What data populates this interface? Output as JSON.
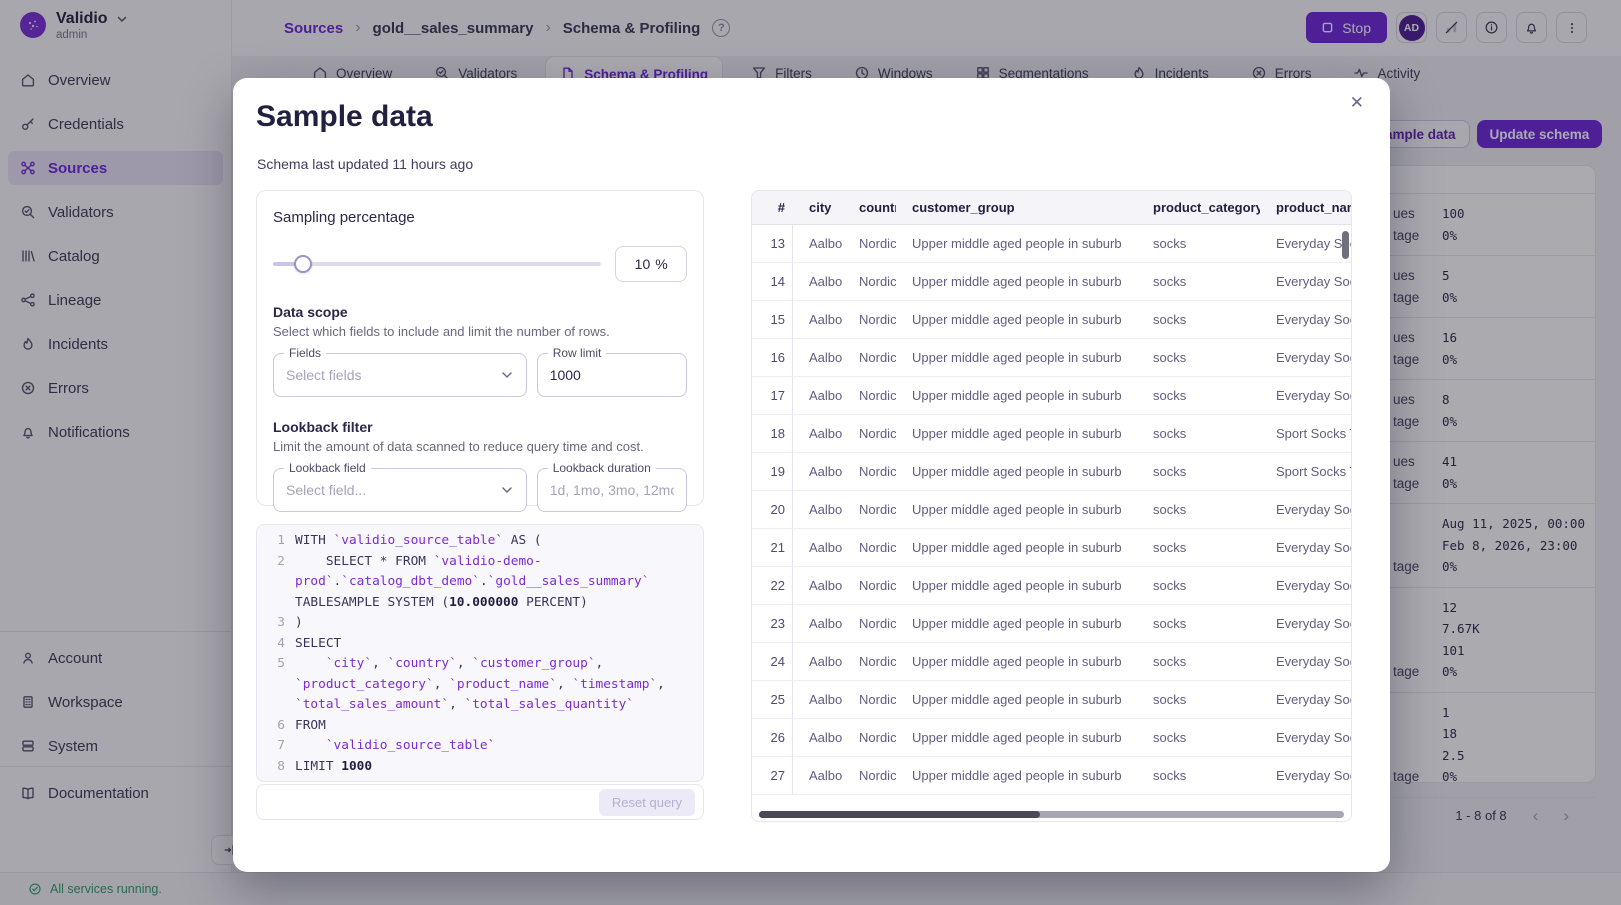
{
  "brand": {
    "name": "Validio",
    "role": "admin"
  },
  "sidebar": {
    "main": [
      {
        "label": "Overview",
        "icon": "home-icon",
        "active": false
      },
      {
        "label": "Credentials",
        "icon": "key-icon",
        "active": false
      },
      {
        "label": "Sources",
        "icon": "sources-icon",
        "active": true
      },
      {
        "label": "Validators",
        "icon": "validator-icon",
        "active": false
      },
      {
        "label": "Catalog",
        "icon": "catalog-icon",
        "active": false
      },
      {
        "label": "Lineage",
        "icon": "lineage-icon",
        "active": false
      },
      {
        "label": "Incidents",
        "icon": "flame-icon",
        "active": false
      },
      {
        "label": "Errors",
        "icon": "error-icon",
        "active": false
      },
      {
        "label": "Notifications",
        "icon": "bell-icon",
        "active": false
      }
    ],
    "secondary": [
      {
        "label": "Account",
        "icon": "person-icon"
      },
      {
        "label": "Workspace",
        "icon": "building-icon"
      },
      {
        "label": "System",
        "icon": "stack-icon"
      }
    ],
    "tertiary": [
      {
        "label": "Documentation",
        "icon": "book-icon"
      }
    ],
    "status": "All services running."
  },
  "header": {
    "breadcrumb": [
      {
        "label": "Sources",
        "link": true
      },
      {
        "label": "gold__sales_summary",
        "link": false
      },
      {
        "label": "Schema & Profiling",
        "link": false
      }
    ],
    "stop_label": "Stop",
    "avatar": "AD"
  },
  "tabs": [
    {
      "label": "Overview",
      "icon": "home-icon",
      "active": false
    },
    {
      "label": "Validators",
      "icon": "validator-icon",
      "active": false
    },
    {
      "label": "Schema & Profiling",
      "icon": "document-icon",
      "active": true
    },
    {
      "label": "Filters",
      "icon": "funnel-icon",
      "active": false
    },
    {
      "label": "Windows",
      "icon": "clock-icon",
      "active": false
    },
    {
      "label": "Segmentations",
      "icon": "grid-icon",
      "active": false
    },
    {
      "label": "Incidents",
      "icon": "flame-icon",
      "active": false
    },
    {
      "label": "Errors",
      "icon": "error-icon",
      "active": false
    },
    {
      "label": "Activity",
      "icon": "activity-icon",
      "active": false
    }
  ],
  "background_panel": {
    "sample_data_label": "Sample data",
    "update_schema_label": "Update schema",
    "stat_groups": [
      {
        "rows": [
          {
            "label": "ues",
            "value": "100"
          },
          {
            "label": "tage",
            "value": "0%"
          }
        ]
      },
      {
        "rows": [
          {
            "label": "ues",
            "value": "5"
          },
          {
            "label": "tage",
            "value": "0%"
          }
        ]
      },
      {
        "rows": [
          {
            "label": "ues",
            "value": "16"
          },
          {
            "label": "tage",
            "value": "0%"
          }
        ]
      },
      {
        "rows": [
          {
            "label": "ues",
            "value": "8"
          },
          {
            "label": "tage",
            "value": "0%"
          }
        ]
      },
      {
        "rows": [
          {
            "label": "ues",
            "value": "41"
          },
          {
            "label": "tage",
            "value": "0%"
          }
        ]
      },
      {
        "rows": [
          {
            "label": "",
            "value": "Aug 11, 2025, 00:00"
          },
          {
            "label": "",
            "value": "Feb 8, 2026, 23:00"
          },
          {
            "label": "tage",
            "value": "0%"
          }
        ]
      },
      {
        "rows": [
          {
            "label": "",
            "value": "12"
          },
          {
            "label": "",
            "value": "7.67K"
          },
          {
            "label": "",
            "value": "101"
          },
          {
            "label": "tage",
            "value": "0%"
          }
        ]
      },
      {
        "rows": [
          {
            "label": "",
            "value": "1"
          },
          {
            "label": "",
            "value": "18"
          },
          {
            "label": "",
            "value": "2.5"
          },
          {
            "label": "tage",
            "value": "0%"
          }
        ]
      }
    ],
    "pagination": "1 - 8 of 8"
  },
  "modal": {
    "title": "Sample data",
    "subtitle": "Schema last updated 11 hours ago",
    "sampling": {
      "label": "Sampling percentage",
      "value": "10",
      "unit": "%",
      "percent": 9
    },
    "data_scope": {
      "title": "Data scope",
      "description": "Select which fields to include and limit the number of rows.",
      "fields_label": "Fields",
      "fields_placeholder": "Select fields",
      "row_limit_label": "Row limit",
      "row_limit_value": "1000"
    },
    "lookback": {
      "title": "Lookback filter",
      "description": "Limit the amount of data scanned to reduce query time and cost.",
      "field_label": "Lookback field",
      "field_placeholder": "Select field...",
      "duration_label": "Lookback duration",
      "duration_placeholder": "1d, 1mo, 3mo, 12mo"
    },
    "reset_label": "Reset query",
    "code": {
      "lines": [
        {
          "n": "1",
          "segs": [
            [
              "k",
              "WITH "
            ],
            [
              "i",
              "`validio_source_table`"
            ],
            [
              "k",
              " AS ("
            ]
          ]
        },
        {
          "n": "2",
          "segs": [
            [
              "k",
              "    SELECT * FROM "
            ],
            [
              "i",
              "`validio-demo-prod`"
            ],
            [
              "k",
              "."
            ],
            [
              "i",
              "`catalog_dbt_demo`"
            ],
            [
              "k",
              "."
            ],
            [
              "i",
              "`gold__sales_summary`"
            ],
            [
              "k",
              " TABLESAMPLE SYSTEM ("
            ],
            [
              "n",
              "10.000000"
            ],
            [
              "k",
              " PERCENT)"
            ]
          ]
        },
        {
          "n": "3",
          "segs": [
            [
              "k",
              ")"
            ]
          ]
        },
        {
          "n": "4",
          "segs": [
            [
              "k",
              "SELECT"
            ]
          ]
        },
        {
          "n": "5",
          "segs": [
            [
              "k",
              "    "
            ],
            [
              "i",
              "`city`"
            ],
            [
              "k",
              ", "
            ],
            [
              "i",
              "`country`"
            ],
            [
              "k",
              ", "
            ],
            [
              "i",
              "`customer_group`"
            ],
            [
              "k",
              ", "
            ],
            [
              "i",
              "`product_category`"
            ],
            [
              "k",
              ", "
            ],
            [
              "i",
              "`product_name`"
            ],
            [
              "k",
              ", "
            ],
            [
              "i",
              "`timestamp`"
            ],
            [
              "k",
              ", "
            ],
            [
              "i",
              "`total_sales_amount`"
            ],
            [
              "k",
              ", "
            ],
            [
              "i",
              "`total_sales_quantity`"
            ]
          ]
        },
        {
          "n": "6",
          "segs": [
            [
              "k",
              "FROM"
            ]
          ]
        },
        {
          "n": "7",
          "segs": [
            [
              "k",
              "    "
            ],
            [
              "i",
              "`validio_source_table`"
            ]
          ]
        },
        {
          "n": "8",
          "segs": [
            [
              "k",
              "LIMIT "
            ],
            [
              "n",
              "1000"
            ]
          ]
        }
      ]
    },
    "table": {
      "columns": [
        "#",
        "city",
        "country",
        "customer_group",
        "product_category",
        "product_name"
      ],
      "rows": [
        [
          "13",
          "Aalborg",
          "Nordics",
          "Upper middle aged people in suburb",
          "socks",
          "Everyday Soc"
        ],
        [
          "14",
          "Aalborg",
          "Nordics",
          "Upper middle aged people in suburb",
          "socks",
          "Everyday Soc"
        ],
        [
          "15",
          "Aalborg",
          "Nordics",
          "Upper middle aged people in suburb",
          "socks",
          "Everyday Soc"
        ],
        [
          "16",
          "Aalborg",
          "Nordics",
          "Upper middle aged people in suburb",
          "socks",
          "Everyday Soc"
        ],
        [
          "17",
          "Aalborg",
          "Nordics",
          "Upper middle aged people in suburb",
          "socks",
          "Everyday Soc"
        ],
        [
          "18",
          "Aalborg",
          "Nordics",
          "Upper middle aged people in suburb",
          "socks",
          "Sport Socks T"
        ],
        [
          "19",
          "Aalborg",
          "Nordics",
          "Upper middle aged people in suburb",
          "socks",
          "Sport Socks T"
        ],
        [
          "20",
          "Aalborg",
          "Nordics",
          "Upper middle aged people in suburb",
          "socks",
          "Everyday Soc"
        ],
        [
          "21",
          "Aalborg",
          "Nordics",
          "Upper middle aged people in suburb",
          "socks",
          "Everyday Soc"
        ],
        [
          "22",
          "Aalborg",
          "Nordics",
          "Upper middle aged people in suburb",
          "socks",
          "Everyday Soc"
        ],
        [
          "23",
          "Aalborg",
          "Nordics",
          "Upper middle aged people in suburb",
          "socks",
          "Everyday Soc"
        ],
        [
          "24",
          "Aalborg",
          "Nordics",
          "Upper middle aged people in suburb",
          "socks",
          "Everyday Soc"
        ],
        [
          "25",
          "Aalborg",
          "Nordics",
          "Upper middle aged people in suburb",
          "socks",
          "Everyday Soc"
        ],
        [
          "26",
          "Aalborg",
          "Nordics",
          "Upper middle aged people in suburb",
          "socks",
          "Everyday Soc"
        ],
        [
          "27",
          "Aalborg",
          "Nordics",
          "Upper middle aged people in suburb",
          "socks",
          "Everyday Soc"
        ]
      ]
    }
  },
  "colors": {
    "accent": "#6D28D9",
    "status_ok": "#2E9E6B"
  }
}
